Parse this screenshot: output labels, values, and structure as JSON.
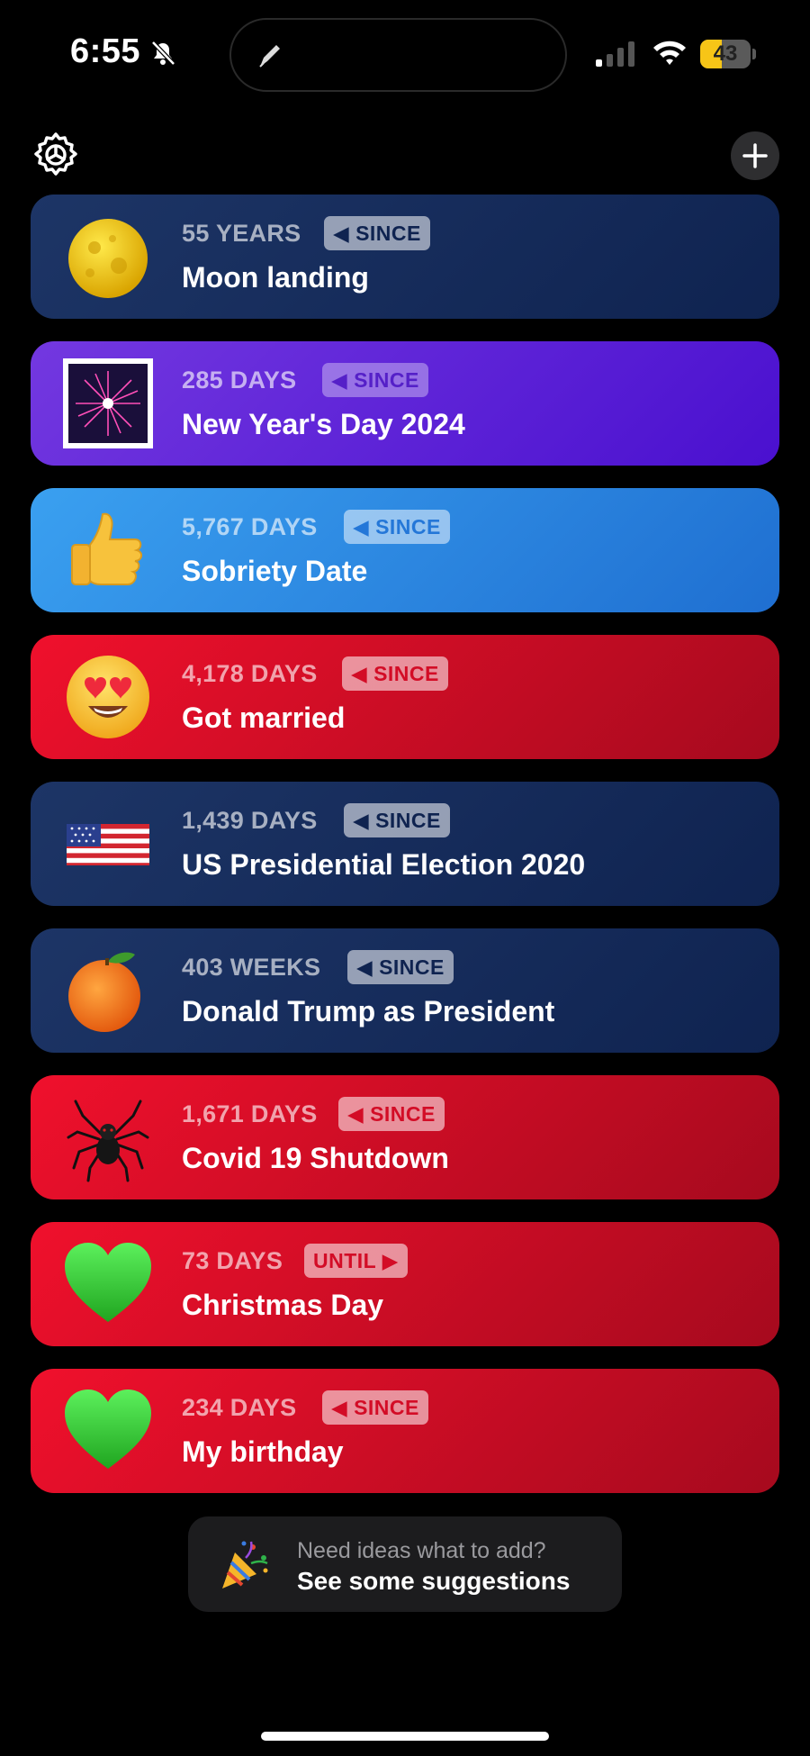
{
  "status_bar": {
    "time": "6:55",
    "battery": "43",
    "battery_level": 0.43
  },
  "toolbar": {
    "settings_icon": "gear-icon",
    "add_icon": "plus-icon"
  },
  "events": [
    {
      "count": "55 YEARS",
      "direction": "◀ SINCE",
      "title": "Moon landing",
      "icon": "moon-icon",
      "theme": "navy"
    },
    {
      "count": "285 DAYS",
      "direction": "◀ SINCE",
      "title": "New Year's Day 2024",
      "icon": "fireworks-icon",
      "theme": "purple"
    },
    {
      "count": "5,767 DAYS",
      "direction": "◀ SINCE",
      "title": "Sobriety Date",
      "icon": "thumbs-up-icon",
      "theme": "blue"
    },
    {
      "count": "4,178 DAYS",
      "direction": "◀ SINCE",
      "title": "Got married",
      "icon": "heart-eyes-icon",
      "theme": "red"
    },
    {
      "count": "1,439 DAYS",
      "direction": "◀ SINCE",
      "title": "US Presidential Election 2020",
      "icon": "us-flag-icon",
      "theme": "navy"
    },
    {
      "count": "403 WEEKS",
      "direction": "◀ SINCE",
      "title": "Donald Trump as President",
      "icon": "orange-icon",
      "theme": "navy"
    },
    {
      "count": "1,671 DAYS",
      "direction": "◀ SINCE",
      "title": "Covid 19 Shutdown",
      "icon": "spider-icon",
      "theme": "red"
    },
    {
      "count": "73 DAYS",
      "direction": "UNTIL ▶",
      "title": "Christmas Day",
      "icon": "green-heart-icon",
      "theme": "red"
    },
    {
      "count": "234 DAYS",
      "direction": "◀ SINCE",
      "title": "My birthday",
      "icon": "green-heart-icon",
      "theme": "red"
    }
  ],
  "suggestions": {
    "prompt": "Need ideas what to add?",
    "action": "See some suggestions",
    "icon": "party-popper-icon"
  },
  "colors": {
    "navy": "#1d3566",
    "purple": "#6a2ee0",
    "blue": "#2f8ae6",
    "red": "#e0102a"
  }
}
